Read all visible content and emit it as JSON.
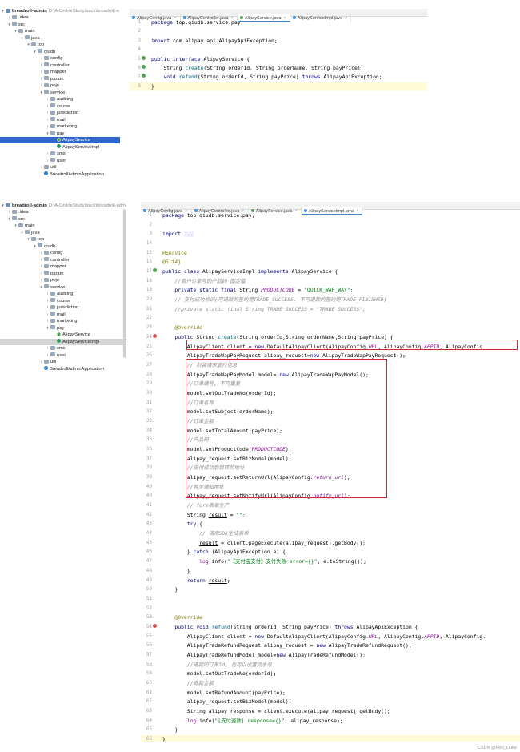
{
  "tree1": {
    "root_label": "breadroll-admin",
    "root_path": "D:\\A-OnlineStudy\\back\\breadroll-a",
    "items": [
      {
        "label": ".idea",
        "icon": "folder-icon",
        "depth": 1,
        "exp": "closed"
      },
      {
        "label": "src",
        "icon": "folder-icon",
        "depth": 1,
        "exp": "open"
      },
      {
        "label": "main",
        "icon": "folder-icon",
        "depth": 2,
        "exp": "open"
      },
      {
        "label": "java",
        "icon": "folder-icon",
        "depth": 3,
        "exp": "open"
      },
      {
        "label": "top",
        "icon": "folder-icon",
        "depth": 4,
        "exp": "open"
      },
      {
        "label": "qiudb",
        "icon": "folder-icon",
        "depth": 5,
        "exp": "open"
      },
      {
        "label": "config",
        "icon": "folder-icon",
        "depth": 6,
        "exp": "closed"
      },
      {
        "label": "controller",
        "icon": "folder-icon",
        "depth": 6,
        "exp": "closed"
      },
      {
        "label": "mapper",
        "icon": "folder-icon",
        "depth": 6,
        "exp": "closed"
      },
      {
        "label": "param",
        "icon": "folder-icon",
        "depth": 6,
        "exp": "closed"
      },
      {
        "label": "pojo",
        "icon": "folder-icon",
        "depth": 6,
        "exp": "closed"
      },
      {
        "label": "service",
        "icon": "folder-icon",
        "depth": 6,
        "exp": "open"
      },
      {
        "label": "auditing",
        "icon": "folder-icon",
        "depth": 7,
        "exp": "closed"
      },
      {
        "label": "course",
        "icon": "folder-icon",
        "depth": 7,
        "exp": "closed"
      },
      {
        "label": "jurisdiction",
        "icon": "folder-icon",
        "depth": 7,
        "exp": "closed"
      },
      {
        "label": "mail",
        "icon": "folder-icon",
        "depth": 7,
        "exp": "closed"
      },
      {
        "label": "marketing",
        "icon": "folder-icon",
        "depth": 7,
        "exp": "closed"
      },
      {
        "label": "pay",
        "icon": "folder-icon",
        "depth": 7,
        "exp": "open"
      },
      {
        "label": "AlipayService",
        "icon": "interface-icon",
        "depth": 8,
        "exp": "none",
        "selected": true
      },
      {
        "label": "AlipayServiceImpl",
        "icon": "class-icon",
        "depth": 8,
        "exp": "none"
      },
      {
        "label": "sms",
        "icon": "folder-icon",
        "depth": 7,
        "exp": "closed"
      },
      {
        "label": "user",
        "icon": "folder-icon",
        "depth": 7,
        "exp": "closed"
      },
      {
        "label": "util",
        "icon": "folder-icon",
        "depth": 6,
        "exp": "closed"
      },
      {
        "label": "BreadrollAdminApplication",
        "icon": "app-icon",
        "depth": 6,
        "exp": "none"
      }
    ]
  },
  "tree2": {
    "root_label": "breadroll-admin",
    "root_path": "D:\\A-OnlineStudy\\back\\breadroll-adm",
    "items": [
      {
        "label": ".idea",
        "icon": "folder-icon",
        "depth": 1,
        "exp": "closed"
      },
      {
        "label": "src",
        "icon": "folder-icon",
        "depth": 1,
        "exp": "open"
      },
      {
        "label": "main",
        "icon": "folder-icon",
        "depth": 2,
        "exp": "open"
      },
      {
        "label": "java",
        "icon": "folder-icon",
        "depth": 3,
        "exp": "open"
      },
      {
        "label": "top",
        "icon": "folder-icon",
        "depth": 4,
        "exp": "open"
      },
      {
        "label": "qiudb",
        "icon": "folder-icon",
        "depth": 5,
        "exp": "open"
      },
      {
        "label": "config",
        "icon": "folder-icon",
        "depth": 6,
        "exp": "closed"
      },
      {
        "label": "controller",
        "icon": "folder-icon",
        "depth": 6,
        "exp": "closed"
      },
      {
        "label": "mapper",
        "icon": "folder-icon",
        "depth": 6,
        "exp": "closed"
      },
      {
        "label": "param",
        "icon": "folder-icon",
        "depth": 6,
        "exp": "closed"
      },
      {
        "label": "pojo",
        "icon": "folder-icon",
        "depth": 6,
        "exp": "closed"
      },
      {
        "label": "service",
        "icon": "folder-icon",
        "depth": 6,
        "exp": "open"
      },
      {
        "label": "auditing",
        "icon": "folder-icon",
        "depth": 7,
        "exp": "closed"
      },
      {
        "label": "course",
        "icon": "folder-icon",
        "depth": 7,
        "exp": "closed"
      },
      {
        "label": "jurisdiction",
        "icon": "folder-icon",
        "depth": 7,
        "exp": "closed"
      },
      {
        "label": "mail",
        "icon": "folder-icon",
        "depth": 7,
        "exp": "closed"
      },
      {
        "label": "marketing",
        "icon": "folder-icon",
        "depth": 7,
        "exp": "closed"
      },
      {
        "label": "pay",
        "icon": "folder-icon",
        "depth": 7,
        "exp": "open"
      },
      {
        "label": "AlipayService",
        "icon": "interface-icon",
        "depth": 8,
        "exp": "none"
      },
      {
        "label": "AlipayServiceImpl",
        "icon": "class-icon",
        "depth": 8,
        "exp": "none",
        "selected_grey": true
      },
      {
        "label": "sms",
        "icon": "folder-icon",
        "depth": 7,
        "exp": "closed"
      },
      {
        "label": "user",
        "icon": "folder-icon",
        "depth": 7,
        "exp": "closed"
      },
      {
        "label": "util",
        "icon": "folder-icon",
        "depth": 6,
        "exp": "closed"
      },
      {
        "label": "BreadrollAdminApplication",
        "icon": "app-icon",
        "depth": 6,
        "exp": "none"
      }
    ]
  },
  "editor1": {
    "tabs": [
      {
        "label": "AlipayConfig.java",
        "kind": "class",
        "active": false
      },
      {
        "label": "AlipayController.java",
        "kind": "class",
        "active": false
      },
      {
        "label": "AlipayService.java",
        "kind": "interface",
        "active": true
      },
      {
        "label": "AlipayServiceImpl.java",
        "kind": "class",
        "active": false
      }
    ],
    "lines": [
      {
        "n": "1",
        "html": "<span class=\"kw\">package</span> top.qiudb.service.pay;"
      },
      {
        "n": "2",
        "html": ""
      },
      {
        "n": "3",
        "html": "<span class=\"kw\">import</span> com.alipay.api.AlipayApiException;"
      },
      {
        "n": "4",
        "html": ""
      },
      {
        "n": "5",
        "gut": "impl",
        "html": "<span class=\"kw\">public interface</span> AlipayService {"
      },
      {
        "n": "6",
        "gut": "impl",
        "html": "    String <span class=\"fn\">create</span>(String orderId, String orderName, String payPrice);"
      },
      {
        "n": "7",
        "gut": "impl",
        "html": "    <span class=\"kw\">void</span> <span class=\"fn\">refund</span>(String orderId, String payPrice) <span class=\"kw\">throws</span> AlipayApiException;"
      },
      {
        "n": "8",
        "hl": true,
        "html": "}"
      }
    ]
  },
  "editor2": {
    "tabs": [
      {
        "label": "AlipayConfig.java",
        "kind": "class",
        "active": false
      },
      {
        "label": "AlipayController.java",
        "kind": "class",
        "active": false
      },
      {
        "label": "AlipayService.java",
        "kind": "interface",
        "active": false
      },
      {
        "label": "AlipayServiceImpl.java",
        "kind": "class",
        "active": true
      }
    ],
    "lines": [
      {
        "n": "1",
        "html": "<span class=\"kw\">package</span> top.qiudb.service.pay;"
      },
      {
        "n": "2",
        "html": ""
      },
      {
        "n": "3",
        "html": "<span class=\"kw\">import</span> <span class=\"cm\" style=\"font-style:normal;background:#eef\">...</span>"
      },
      {
        "n": "14",
        "html": ""
      },
      {
        "n": "15",
        "html": "<span class=\"ann\">@Service</span>"
      },
      {
        "n": "16",
        "html": "<span class=\"ann\">@Slf4j</span>"
      },
      {
        "n": "17",
        "gut": "impl",
        "html": "<span class=\"kw\">public class</span> AlipayServiceImpl <span class=\"kw\">implements</span> AlipayService {"
      },
      {
        "n": "18",
        "html": "    <span class=\"cm\">//商户订单号的产品码 固定值</span>"
      },
      {
        "n": "19",
        "html": "    <span class=\"kw\">private static final</span> String <span class=\"fld\">PRODUCTCODE</span> = <span class=\"str\">\"QUICK_WAP_WAY\"</span>;"
      },
      {
        "n": "20",
        "html": "    <span class=\"cm\">// 支付成功标识(可退款的签约是TRADE_SUCCESS. 不可退款的签约是TRADE_FINISHED)</span>"
      },
      {
        "n": "21",
        "html": "    <span class=\"cm\">//private static final String TRADE_SUCCESS = \"TRADE_SUCCESS\";</span>"
      },
      {
        "n": "22",
        "html": ""
      },
      {
        "n": "23",
        "html": "    <span class=\"ann\">@Override</span>"
      },
      {
        "n": "24",
        "gut": "override",
        "html": "    <span class=\"kw\">public</span> String <span class=\"fn\">create</span>(String orderId,String orderName,String payPrice) {"
      },
      {
        "n": "25",
        "html": "        AlipayClient client = <span class=\"kw\">new</span> DefaultAlipayClient(AlipayConfig.<span class=\"fld\">URL</span>, AlipayConfig.<span class=\"fld\">APPID</span>, AlipayConfig."
      },
      {
        "n": "26",
        "html": "        AlipayTradeWapPayRequest alipay_request=<span class=\"kw\">new</span> AlipayTradeWapPayRequest();"
      },
      {
        "n": "27",
        "html": "        <span class=\"cm\">// 封装请求支付信息</span>"
      },
      {
        "n": "28",
        "html": "        AlipayTradeWapPayModel model= <span class=\"kw\">new</span> AlipayTradeWapPayModel();"
      },
      {
        "n": "29",
        "html": "        <span class=\"cm\">//订单编号, 不可重复</span>"
      },
      {
        "n": "30",
        "html": "        model.setOutTradeNo(orderId);"
      },
      {
        "n": "31",
        "html": "        <span class=\"cm\">//订单名称</span>"
      },
      {
        "n": "32",
        "html": "        model.setSubject(orderName);"
      },
      {
        "n": "33",
        "html": "        <span class=\"cm\">//订单金额</span>"
      },
      {
        "n": "34",
        "html": "        model.setTotalAmount(payPrice);"
      },
      {
        "n": "35",
        "html": "        <span class=\"cm\">//产品码</span>"
      },
      {
        "n": "36",
        "html": "        model.setProductCode(<span class=\"fld\">PRODUCTCODE</span>);"
      },
      {
        "n": "37",
        "html": "        alipay_request.setBizModel(model);"
      },
      {
        "n": "38",
        "html": "        <span class=\"cm\">//支付成功后跳转的地址</span>"
      },
      {
        "n": "39",
        "html": "        alipay_request.setReturnUrl(AlipayConfig.<span class=\"fld\">return_url</span>);"
      },
      {
        "n": "40",
        "html": "        <span class=\"cm\">//异步通知地址</span>"
      },
      {
        "n": "40",
        "html": "        alipay_request.setNotifyUrl(AlipayConfig.<span class=\"fld\">notify_url</span>);"
      },
      {
        "n": "41",
        "html": "        <span class=\"cm\">// form表单生产</span>"
      },
      {
        "n": "42",
        "html": "        String <u>result</u> = <span class=\"str\">\"\"</span>;"
      },
      {
        "n": "43",
        "html": "        <span class=\"kw\">try</span> {"
      },
      {
        "n": "44",
        "html": "            <span class=\"cm\">// 调用SDK生成表单</span>"
      },
      {
        "n": "45",
        "html": "            <u>result</u> = client.pageExecute(alipay_request).getBody();"
      },
      {
        "n": "46",
        "html": "        } <span class=\"kw\">catch</span> (AlipayApiException e) {"
      },
      {
        "n": "47",
        "html": "            <span class=\"lg\">log</span>.info(<span class=\"str\">\"【支付宝支付】支付失败 error={}\"</span>, e.toString());"
      },
      {
        "n": "48",
        "html": "        }"
      },
      {
        "n": "49",
        "html": "        <span class=\"kw\">return</span> <u>result</u>;"
      },
      {
        "n": "50",
        "html": "    }"
      },
      {
        "n": "51",
        "html": ""
      },
      {
        "n": "52",
        "html": ""
      },
      {
        "n": "53",
        "html": "    <span class=\"ann\">@Override</span>"
      },
      {
        "n": "54",
        "gut": "override",
        "html": "    <span class=\"kw\">public void</span> <span class=\"fn\">refund</span>(String orderId, String payPrice) <span class=\"kw\">throws</span> AlipayApiException {"
      },
      {
        "n": "55",
        "html": "        AlipayClient client = <span class=\"kw\">new</span> DefaultAlipayClient(AlipayConfig.<span class=\"fld\">URL</span>, AlipayConfig.<span class=\"fld\">APPID</span>, AlipayConfig."
      },
      {
        "n": "56",
        "html": "        AlipayTradeRefundRequest alipay_request = <span class=\"kw\">new</span> AlipayTradeRefundRequest();"
      },
      {
        "n": "57",
        "html": "        AlipayTradeRefundModel model=<span class=\"kw\">new</span> AlipayTradeRefundModel();"
      },
      {
        "n": "58",
        "html": "        <span class=\"cm\">//退款的订单Id, 也可以设置流水号</span>"
      },
      {
        "n": "59",
        "html": "        model.setOutTradeNo(orderId);"
      },
      {
        "n": "60",
        "html": "        <span class=\"cm\">//退款金额</span>"
      },
      {
        "n": "61",
        "html": "        model.setRefundAmount(payPrice);"
      },
      {
        "n": "62",
        "html": "        alipay_request.setBizModel(model);"
      },
      {
        "n": "63",
        "html": "        String alipay_response = client.execute(alipay_request).getBody();"
      },
      {
        "n": "64",
        "html": "        <span class=\"lg\">log</span>.info(<span class=\"str\">\"[支付退款] response={}\"</span>, alipay_response);"
      },
      {
        "n": "65",
        "html": "    }"
      },
      {
        "n": "66",
        "hl": true,
        "html": "}"
      }
    ]
  },
  "watermark": "CSDN @Hou_Liuke"
}
